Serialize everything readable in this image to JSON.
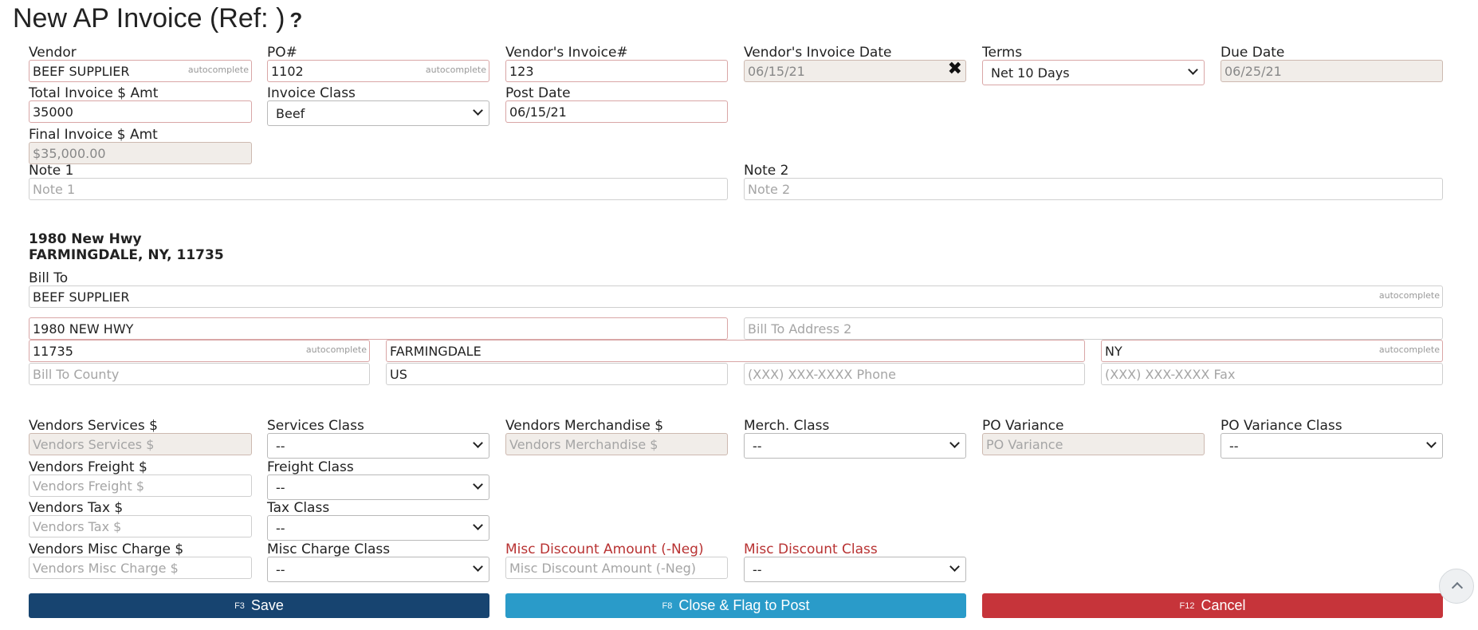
{
  "title": "New AP Invoice (Ref: )",
  "help_icon": "?",
  "autocomplete_hint": "autocomplete",
  "labels": {
    "vendor": "Vendor",
    "po": "PO#",
    "vendor_invoice": "Vendor's Invoice#",
    "vendor_invoice_date": "Vendor's Invoice Date",
    "terms": "Terms",
    "due_date": "Due Date",
    "total_invoice": "Total Invoice $ Amt",
    "invoice_class": "Invoice Class",
    "post_date": "Post Date",
    "final_invoice": "Final Invoice $ Amt",
    "note1": "Note 1",
    "note2": "Note 2",
    "bill_to": "Bill To",
    "vendors_services": "Vendors Services $",
    "services_class": "Services Class",
    "vendors_merch": "Vendors Merchandise $",
    "merch_class": "Merch. Class",
    "po_variance": "PO Variance",
    "po_variance_class": "PO Variance Class",
    "vendors_freight": "Vendors Freight $",
    "freight_class": "Freight Class",
    "vendors_tax": "Vendors Tax $",
    "tax_class": "Tax Class",
    "vendors_misc": "Vendors Misc Charge $",
    "misc_class": "Misc Charge Class",
    "misc_discount": "Misc Discount Amount (-Neg)",
    "misc_discount_class": "Misc Discount Class"
  },
  "values": {
    "vendor": "BEEF SUPPLIER",
    "po": "1102",
    "vendor_invoice": "123",
    "vendor_invoice_date": "06/15/21",
    "terms": "Net 10 Days",
    "due_date": "06/25/21",
    "total_invoice": "35000",
    "invoice_class": "Beef",
    "post_date": "06/15/21",
    "final_invoice": "$35,000.00",
    "bill_to_name": "BEEF SUPPLIER",
    "bill_to_address1": "1980 NEW HWY",
    "bill_to_zip": "11735",
    "bill_to_city": "FARMINGDALE",
    "bill_to_state": "NY",
    "bill_to_country": "US",
    "class_default": "--"
  },
  "placeholders": {
    "note1": "Note 1",
    "note2": "Note 2",
    "bill_to_address2": "Bill To Address 2",
    "bill_to_county": "Bill To County",
    "phone": "(XXX) XXX-XXXX Phone",
    "fax": "(XXX) XXX-XXXX Fax",
    "vendors_services": "Vendors Services $",
    "vendors_merch": "Vendors Merchandise $",
    "po_variance": "PO Variance",
    "vendors_freight": "Vendors Freight $",
    "vendors_tax": "Vendors Tax $",
    "vendors_misc": "Vendors Misc Charge $",
    "misc_discount": "Misc Discount Amount (-Neg)"
  },
  "address": {
    "line1": "1980 New Hwy",
    "line2": "FARMINGDALE, NY, 11735"
  },
  "buttons": {
    "save_key": "F3",
    "save": "Save",
    "post_key": "F8",
    "post": "Close & Flag to Post",
    "cancel_key": "F12",
    "cancel": "Cancel"
  },
  "icons": {
    "clear": "close-icon",
    "help": "help-icon",
    "scroll_top": "chevron-up-icon"
  },
  "colors": {
    "save": "#174470",
    "post": "#2a9bc9",
    "cancel": "#c6343a",
    "discount_label": "#b83232"
  }
}
